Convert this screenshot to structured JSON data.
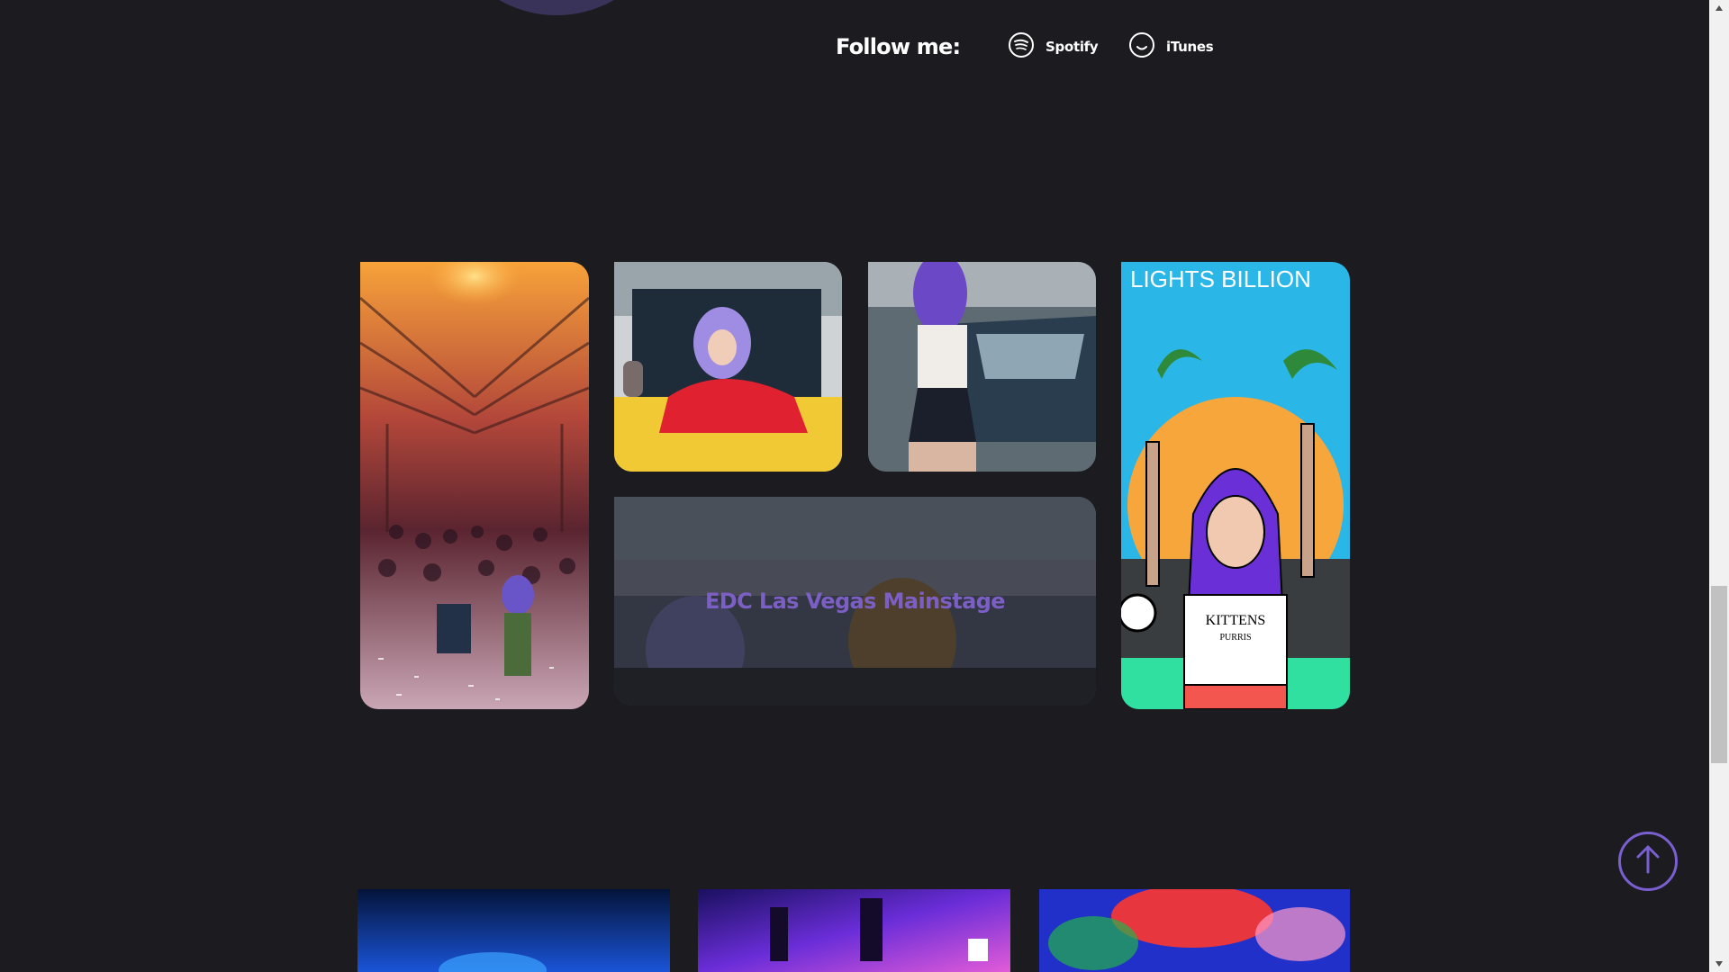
{
  "follow": {
    "label": "Follow me:",
    "links": [
      {
        "label": "Spotify",
        "icon": "spotify-icon"
      },
      {
        "label": "iTunes",
        "icon": "itunes-icon"
      }
    ]
  },
  "gallery": {
    "overlay_title": "EDC Las Vegas Mainstage",
    "tiles": [
      {
        "name": "club-crowd-photo"
      },
      {
        "name": "red-jacket-car-photo"
      },
      {
        "name": "car-back-photo"
      },
      {
        "name": "kittens-illustration",
        "poster_text": "LIGHTS BILLION",
        "shirt_text": "KITTENS",
        "shirt_subtext": "PURRIS"
      },
      {
        "name": "edc-mainstage-photo"
      }
    ]
  },
  "scroll_top": {
    "icon": "arrow-up-icon"
  },
  "colors": {
    "background": "#1c1b20",
    "accent": "#7a5fd1",
    "overlay_text": "#7c5fc4"
  }
}
